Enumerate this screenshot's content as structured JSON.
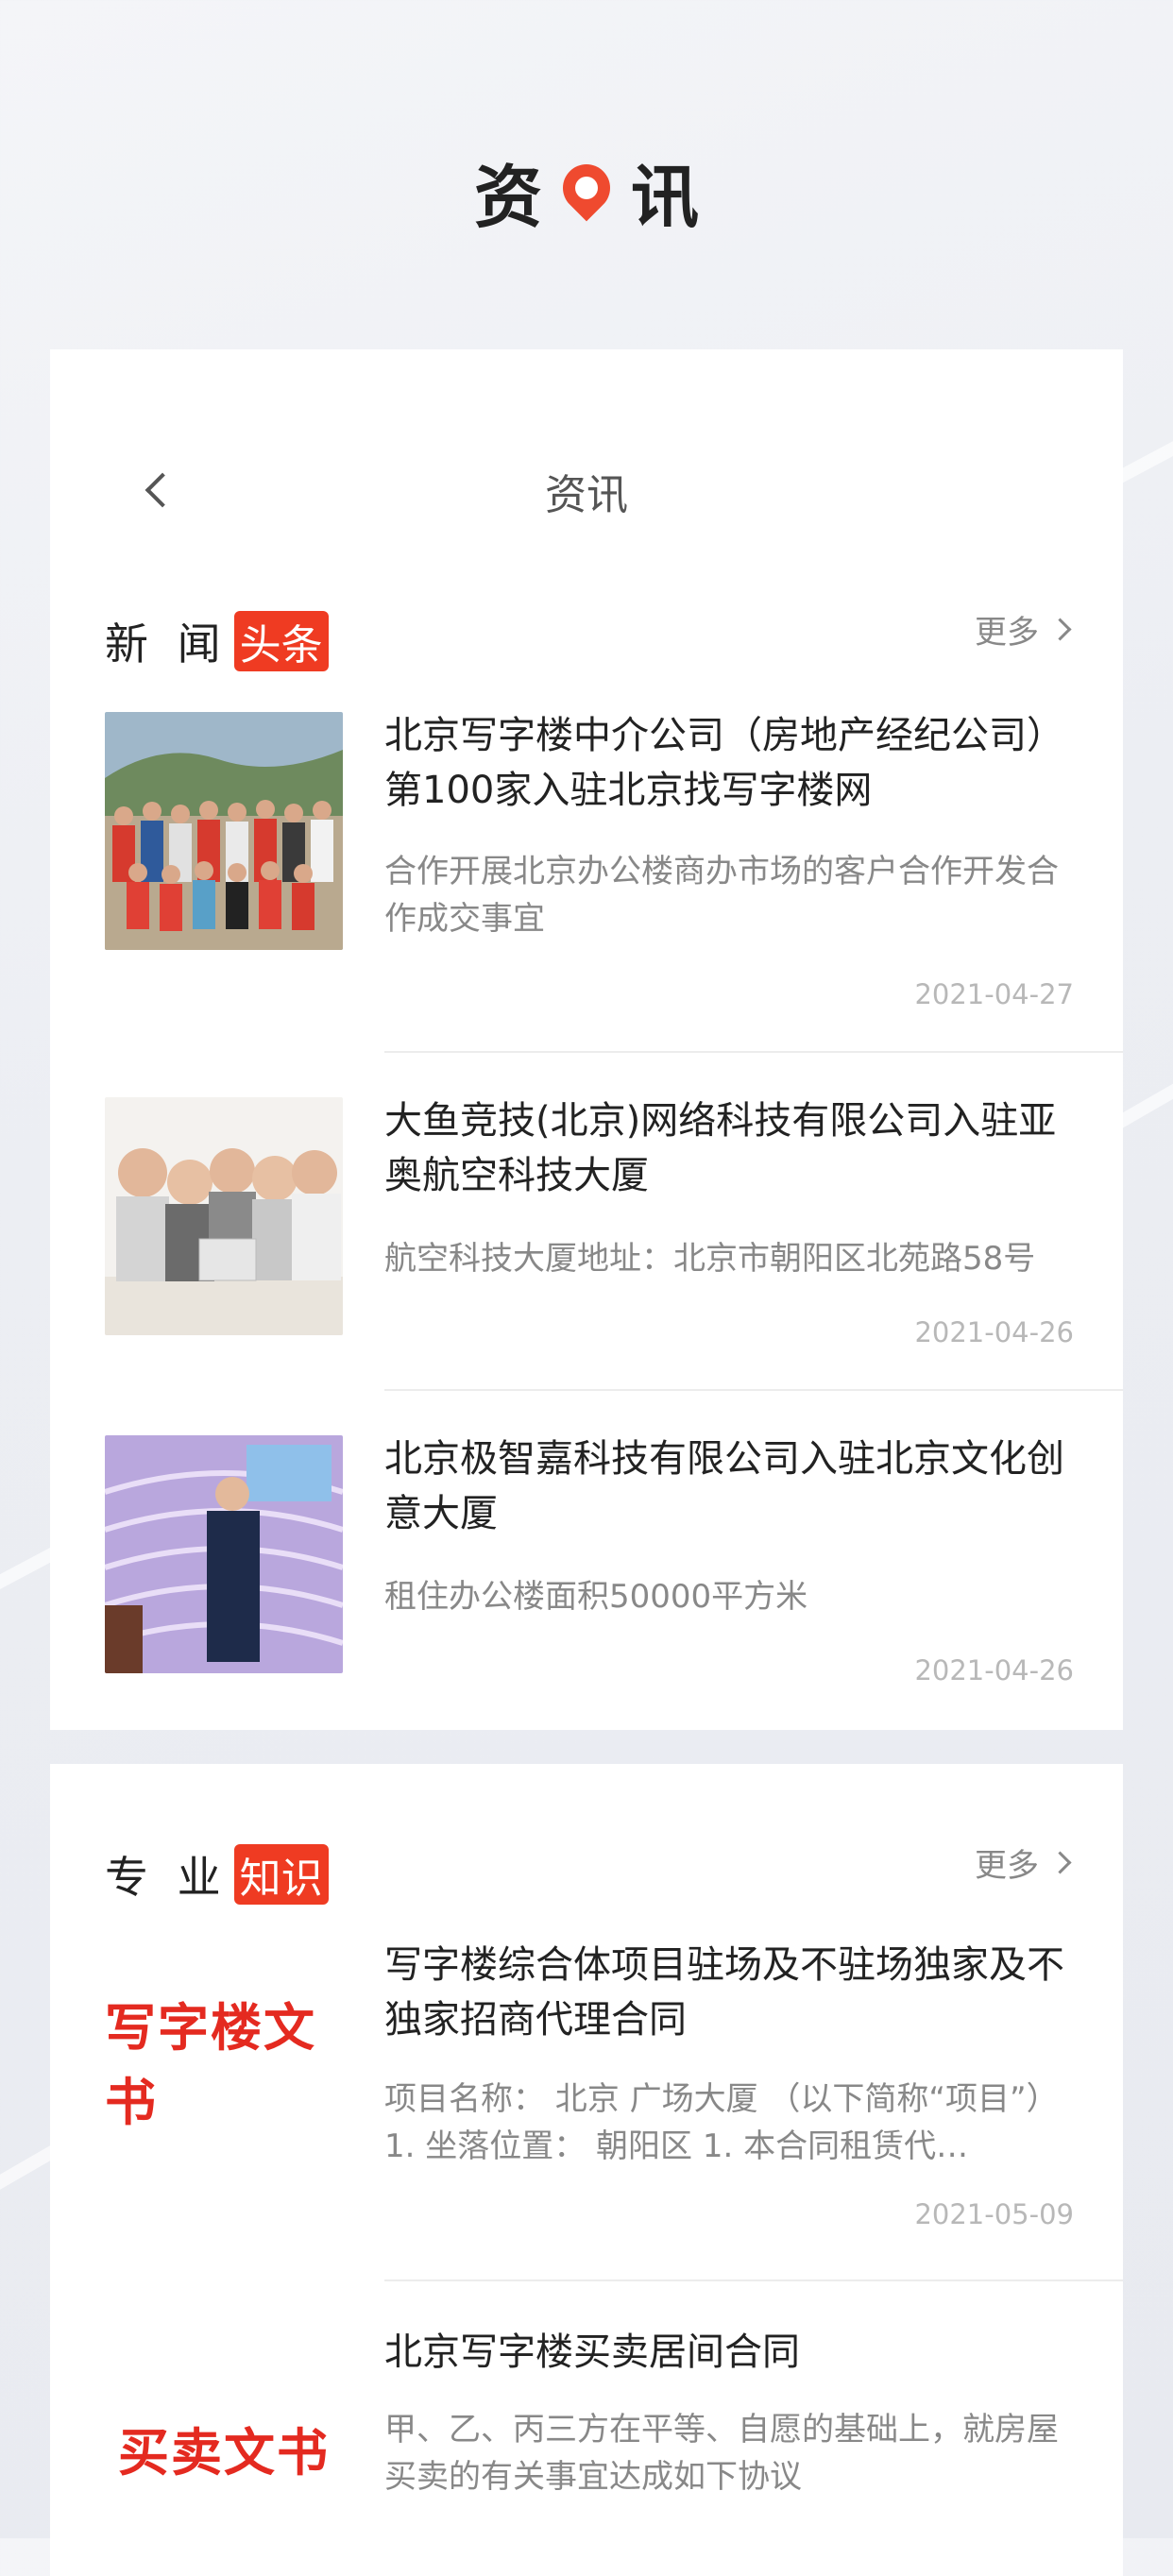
{
  "header": {
    "title_left": "资",
    "title_right": "讯"
  },
  "nav": {
    "title": "资讯"
  },
  "news": {
    "title": "新 闻",
    "tag": "头条",
    "more": "更多",
    "items": [
      {
        "title": "北京写字楼中介公司（房地产经纪公司）第100家入驻北京找写字楼网",
        "desc": "合作开展北京办公楼商办市场的客户合作开发合作成交事宜",
        "date": "2021-04-27"
      },
      {
        "title": "大鱼竞技(北京)网络科技有限公司入驻亚奥航空科技大厦",
        "desc": "航空科技大厦地址：北京市朝阳区北苑路58号",
        "date": "2021-04-26"
      },
      {
        "title": "北京极智嘉科技有限公司入驻北京文化创意大厦",
        "desc": "租住办公楼面积50000平方米",
        "date": "2021-04-26"
      }
    ]
  },
  "knowledge": {
    "title": "专 业",
    "tag": "知识",
    "more": "更多",
    "items": [
      {
        "thumb_text": "写字楼文书",
        "title": "写字楼综合体项目驻场及不驻场独家及不独家招商代理合同",
        "desc": "项目名称： 北京 广场大厦 （以下简称“项目”） 1. 坐落位置： 朝阳区 1. 本合同租赁代…",
        "date": "2021-05-09"
      },
      {
        "thumb_text": "买卖文书",
        "title": "北京写字楼买卖居间合同",
        "desc": "甲、乙、丙三方在平等、自愿的基础上，就房屋买卖的有关事宜达成如下协议",
        "date": ""
      }
    ]
  },
  "colors": {
    "accent": "#ef3b22",
    "text": "#222222",
    "muted": "#888888"
  }
}
